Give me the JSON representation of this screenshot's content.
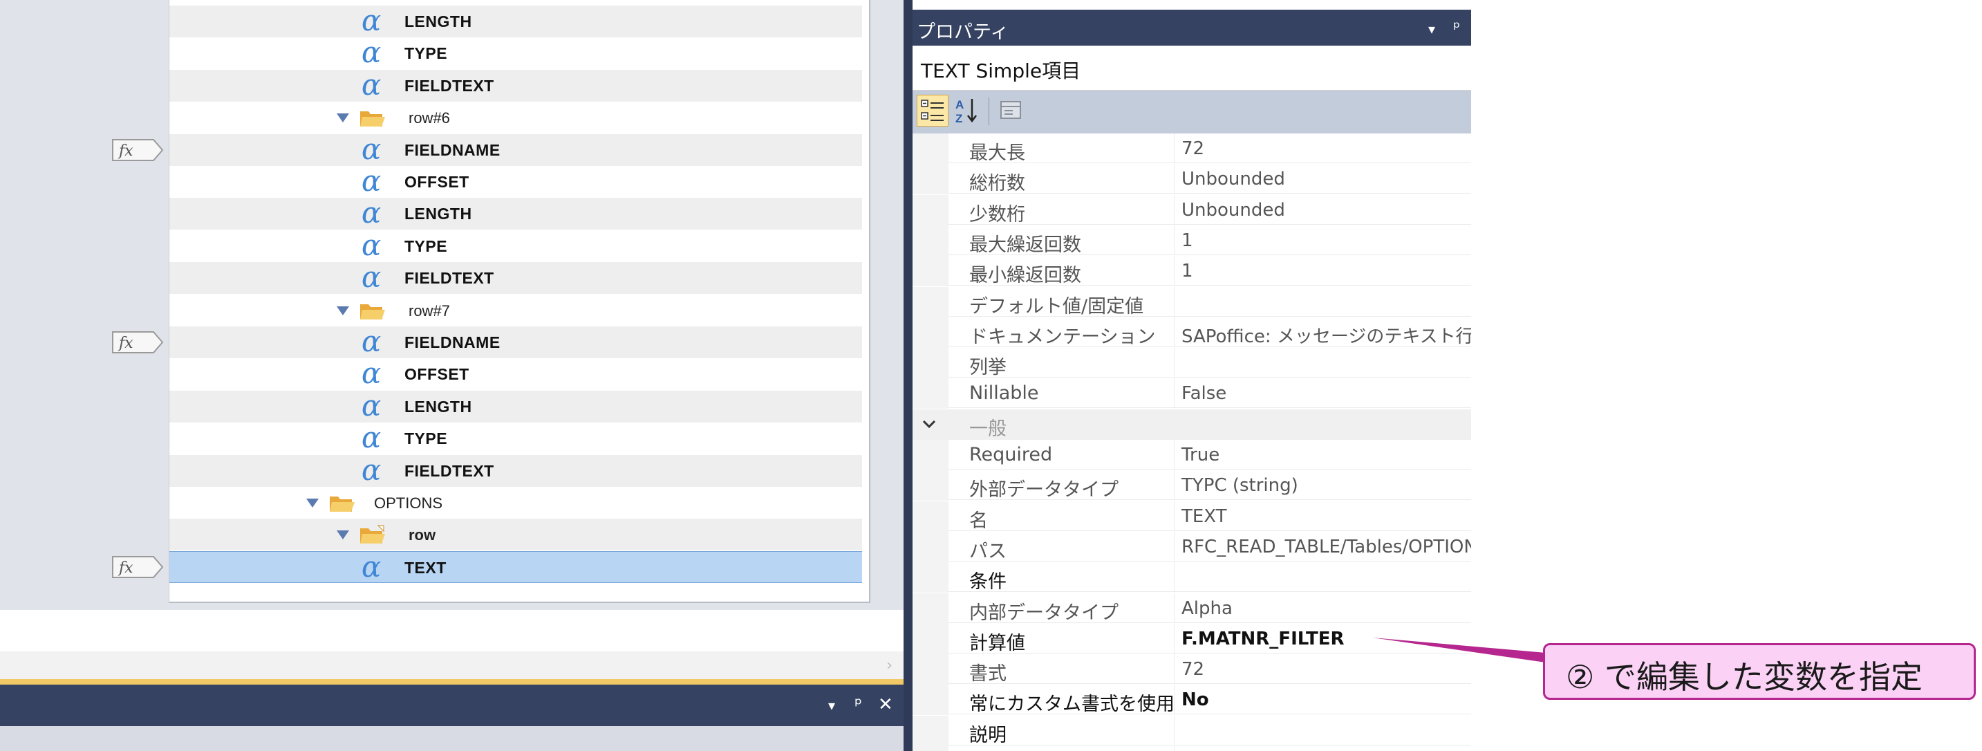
{
  "tree": {
    "rows": [
      {
        "kind": "field",
        "label": "LENGTH",
        "shade": true,
        "fx": false
      },
      {
        "kind": "field",
        "label": "TYPE",
        "shade": false,
        "fx": false
      },
      {
        "kind": "field",
        "label": "FIELDTEXT",
        "shade": true,
        "fx": false
      },
      {
        "kind": "row",
        "label": "row#6",
        "shade": false,
        "fx": false
      },
      {
        "kind": "field",
        "label": "FIELDNAME",
        "shade": true,
        "fx": true
      },
      {
        "kind": "field",
        "label": "OFFSET",
        "shade": false,
        "fx": false
      },
      {
        "kind": "field",
        "label": "LENGTH",
        "shade": true,
        "fx": false
      },
      {
        "kind": "field",
        "label": "TYPE",
        "shade": false,
        "fx": false
      },
      {
        "kind": "field",
        "label": "FIELDTEXT",
        "shade": true,
        "fx": false
      },
      {
        "kind": "row",
        "label": "row#7",
        "shade": false,
        "fx": false
      },
      {
        "kind": "field",
        "label": "FIELDNAME",
        "shade": true,
        "fx": true
      },
      {
        "kind": "field",
        "label": "OFFSET",
        "shade": false,
        "fx": false
      },
      {
        "kind": "field",
        "label": "LENGTH",
        "shade": true,
        "fx": false
      },
      {
        "kind": "field",
        "label": "TYPE",
        "shade": false,
        "fx": false
      },
      {
        "kind": "field",
        "label": "FIELDTEXT",
        "shade": true,
        "fx": false
      },
      {
        "kind": "table",
        "label": "OPTIONS",
        "shade": false,
        "fx": false
      },
      {
        "kind": "row",
        "label": "row",
        "shade": true,
        "fx": false,
        "open": true
      },
      {
        "kind": "field",
        "label": "TEXT",
        "shade": false,
        "fx": true,
        "selected": true
      }
    ],
    "fx_label": "fx"
  },
  "bottom_panel": {
    "controls": [
      "▾",
      "ᵖ",
      "✕"
    ]
  },
  "properties": {
    "title": "プロパティ",
    "header_controls": [
      "▾",
      "ᵖ"
    ],
    "object": "TEXT  Simple項目",
    "rows": [
      {
        "name": "最大長",
        "value": "72"
      },
      {
        "name": "総桁数",
        "value": "Unbounded"
      },
      {
        "name": "少数桁",
        "value": "Unbounded"
      },
      {
        "name": "最大繰返回数",
        "value": "1"
      },
      {
        "name": "最小繰返回数",
        "value": "1"
      },
      {
        "name": "デフォルト値/固定値",
        "value": ""
      },
      {
        "name": "ドキュメンテーション",
        "value": "SAPoffice: メッセージのテキスト行"
      },
      {
        "name": "列挙",
        "value": ""
      },
      {
        "name": "Nillable",
        "value": "False"
      },
      {
        "name": "一般",
        "value": "",
        "category": true
      },
      {
        "name": "Required",
        "value": "True"
      },
      {
        "name": "外部データタイプ",
        "value": "TYPC (string)"
      },
      {
        "name": "名",
        "value": "TEXT"
      },
      {
        "name": "パス",
        "value": "RFC_READ_TABLE/Tables/OPTIONS/row/TEXT"
      },
      {
        "name": "条件",
        "value": "",
        "dark_name": true
      },
      {
        "name": "内部データタイプ",
        "value": "Alpha"
      },
      {
        "name": "計算値",
        "value": "F.MATNR_FILTER",
        "dark_name": true,
        "bold_value": true
      },
      {
        "name": "書式",
        "value": "72"
      },
      {
        "name": "常にカスタム書式を使用",
        "value": "No",
        "dark_name": true,
        "bold_value": true
      },
      {
        "name": "説明",
        "value": "",
        "dark_name": true
      },
      {
        "name": "",
        "value": ""
      }
    ]
  },
  "callout": {
    "text": "② で編集した変数を指定"
  },
  "colors": {
    "panel_header": "#354262",
    "selection": "#b8d5f4",
    "alpha_icon": "#3f86d4",
    "callout_fill": "#fbd2f5",
    "callout_border": "#b5268e"
  }
}
